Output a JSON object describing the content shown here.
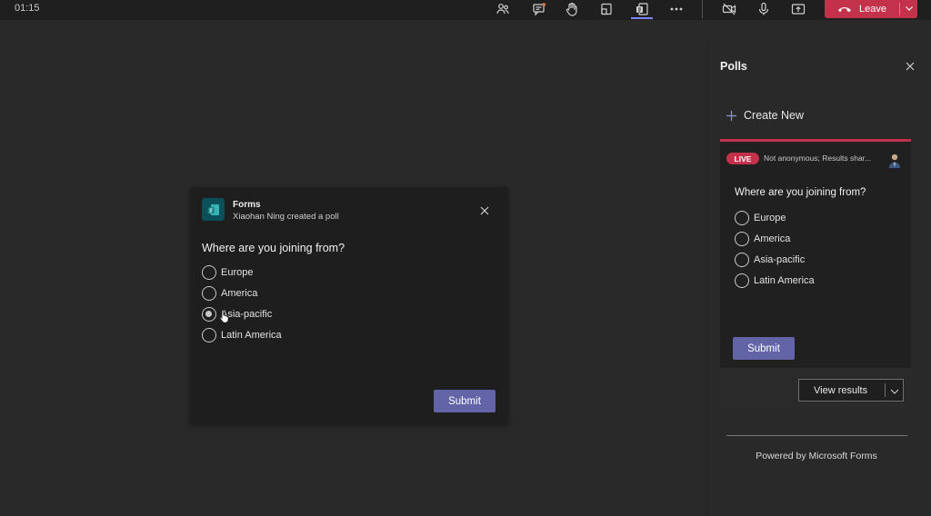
{
  "topbar": {
    "timer": "01:15",
    "icons": [
      "participants-icon",
      "chat-icon",
      "raise-hand-icon",
      "share-tray-icon",
      "forms-apps-icon",
      "more-icon",
      "camera-off-icon",
      "mic-icon",
      "share-screen-icon"
    ],
    "leave_label": "Leave",
    "leave_color": "#c4314b"
  },
  "poll_card": {
    "app_name": "Forms",
    "subtitle": "Xiaohan Ning created a poll",
    "question": "Where are you joining from?",
    "options": [
      "Europe",
      "America",
      "Asia-pacific",
      "Latin America"
    ],
    "hovered_option": "Asia-pacific",
    "submit_label": "Submit"
  },
  "panel": {
    "title": "Polls",
    "create_new": "Create New",
    "live_badge": "LIVE",
    "meta": "Not anonymous; Results shar...",
    "question": "Where are you joining from?",
    "options": [
      "Europe",
      "America",
      "Asia-pacific",
      "Latin America"
    ],
    "submit_label": "Submit",
    "view_results": "View results",
    "powered_by": "Powered by Microsoft Forms"
  },
  "colors": {
    "accent": "#6264a7",
    "live": "#c4314b",
    "active_tab": "#7f85f5"
  }
}
